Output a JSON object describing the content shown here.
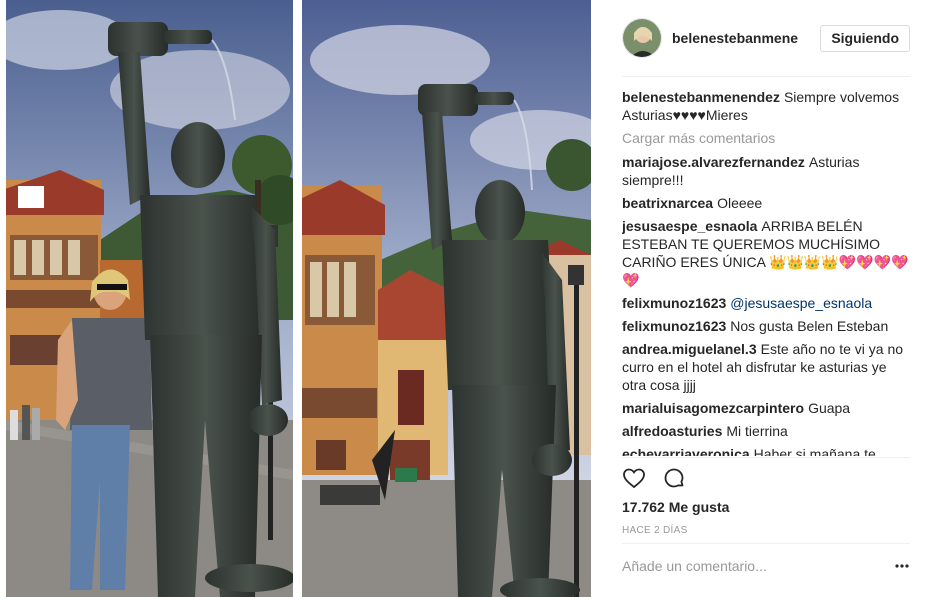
{
  "post": {
    "photo_alt": "Photo collage: statue of cider pourer",
    "header_username": "belenestebanmene",
    "follow_label": "Siguiendo",
    "likes_text": "17.762 Me gusta",
    "date_text": "HACE 2 DÍAS",
    "add_comment_placeholder": "Añade un comentario..."
  },
  "caption": {
    "user": "belenestebanmenendez",
    "text": "Siempre volvemos Asturias♥♥♥♥Mieres"
  },
  "load_more_label": "Cargar más comentarios",
  "comments": [
    {
      "user": "mariajose.alvarezfernandez",
      "text": "Asturias siempre!!!",
      "mention": ""
    },
    {
      "user": "beatrixnarcea",
      "text": "Oleeee",
      "mention": ""
    },
    {
      "user": "jesusaespe_esnaola",
      "text": "ARRIBA BELÉN ESTEBAN TE QUEREMOS MUCHÍSIMO CARIÑO ERES ÚNICA 👑👑👑👑💖💖💖💖💖",
      "mention": ""
    },
    {
      "user": "felixmunoz1623",
      "text": "",
      "mention": "@jesusaespe_esnaola"
    },
    {
      "user": "felixmunoz1623",
      "text": "Nos gusta Belen Esteban",
      "mention": ""
    },
    {
      "user": "andrea.miguelanel.3",
      "text": "Este año no te vi ya no curro en el hotel ah disfrutar ke asturias ye otra cosa jjjj",
      "mention": ""
    },
    {
      "user": "marialuisagomezcarpintero",
      "text": "Guapa",
      "mention": ""
    },
    {
      "user": "alfredoasturies",
      "text": "Mi tierrina",
      "mention": ""
    },
    {
      "user": "echevarriaveronica",
      "text": "Haber si mañana te",
      "mention": ""
    }
  ],
  "icons": {
    "like": "heart-icon",
    "comment": "comment-bubble-icon",
    "more": "more-options-icon"
  },
  "colors": {
    "text": "#262626",
    "muted": "#999999",
    "mention": "#003569",
    "border": "#dbdbdb"
  }
}
